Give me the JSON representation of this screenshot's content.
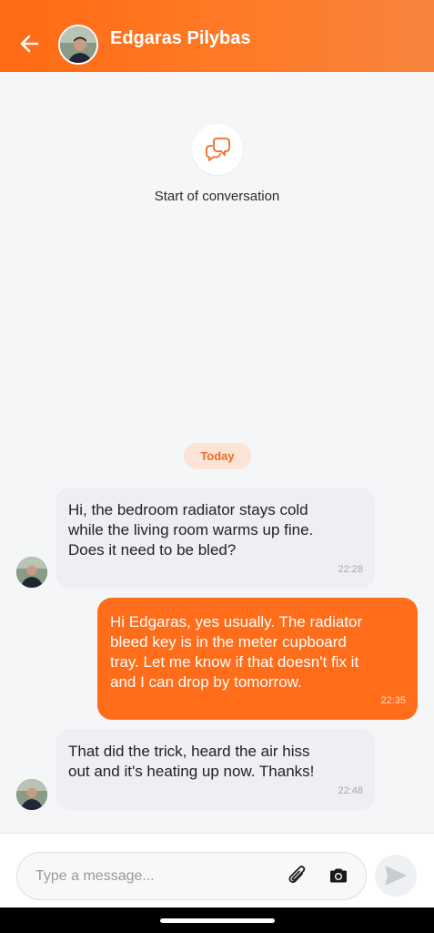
{
  "header": {
    "contact_name": "Edgaras Pilybas",
    "back_icon": "arrow-left-icon",
    "accent_color": "#ff6a13"
  },
  "conversation": {
    "start_label": "Start of conversation",
    "start_icon": "chat-bubbles-icon",
    "date_divider": "Today"
  },
  "messages": [
    {
      "direction": "incoming",
      "text": "Hi, the bedroom radiator stays cold\nwhile the living room warms up fine.\nDoes it need to be bled?",
      "time": "22:28"
    },
    {
      "direction": "outgoing",
      "text": "Hi Edgaras, yes usually. The radiator\nbleed key is in the meter cupboard\ntray. Let me know if that doesn't fix it\nand I can drop by tomorrow.",
      "time": "22:35"
    },
    {
      "direction": "incoming",
      "text": "That did the trick, heard the air hiss\nout and it's heating up now. Thanks!",
      "time": "22:48"
    }
  ],
  "composer": {
    "placeholder": "Type a message...",
    "value": "",
    "attach_icon": "paperclip-icon",
    "camera_icon": "camera-icon",
    "send_icon": "send-icon"
  }
}
